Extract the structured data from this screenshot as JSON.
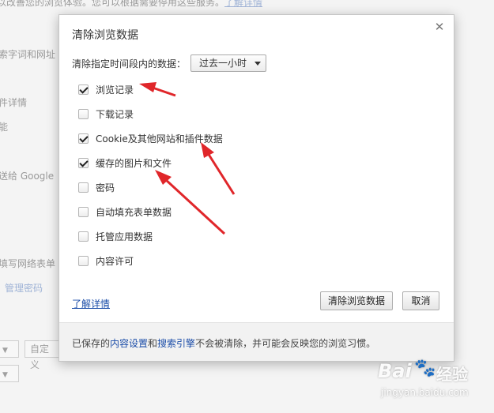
{
  "background": {
    "top_text": "以改善您的浏览体验。您可以根据需要停用这些服务。",
    "top_link": "了解详情",
    "line_search": "索字词和网址",
    "line_details": "件详情",
    "line_func": "能",
    "line_google": "送给 Google",
    "line_forms": "填写网络表单",
    "manage_passwords": "管理密码",
    "custom_button": "自定义"
  },
  "dialog": {
    "title": "清除浏览数据",
    "close_icon": "close-icon",
    "time_range_label": "清除指定时间段内的数据：",
    "time_range_value": "过去一小时",
    "options": [
      {
        "label": "浏览记录",
        "checked": true
      },
      {
        "label": "下载记录",
        "checked": false
      },
      {
        "label": "Cookie及其他网站和插件数据",
        "checked": true
      },
      {
        "label": "缓存的图片和文件",
        "checked": true
      },
      {
        "label": "密码",
        "checked": false
      },
      {
        "label": "自动填充表单数据",
        "checked": false
      },
      {
        "label": "托管应用数据",
        "checked": false
      },
      {
        "label": "内容许可",
        "checked": false
      }
    ],
    "learn_more": "了解详情",
    "clear_button": "清除浏览数据",
    "cancel_button": "取消",
    "footer": {
      "prefix": "已保存的",
      "link1": "内容设置",
      "and": "和",
      "link2": "搜索引擎",
      "suffix": "不会被清除，并可能会反映您的浏览习惯。"
    }
  },
  "annotation_color": "#e0262a",
  "watermark": {
    "brand": "Bai",
    "brand_suffix": "经验",
    "url": "jingyan.baidu.com"
  }
}
